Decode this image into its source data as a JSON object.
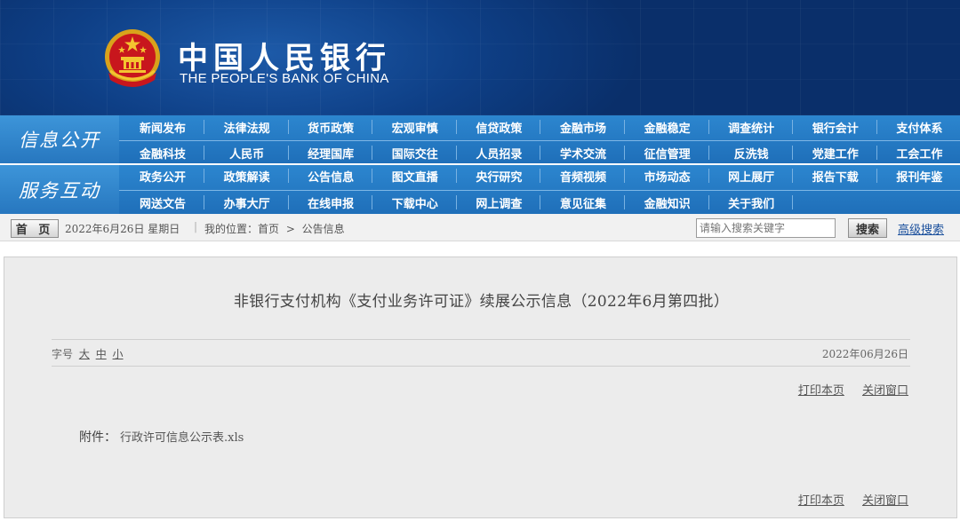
{
  "header": {
    "logo_cn": "中国人民银行",
    "logo_en": "THE PEOPLE'S BANK OF CHINA"
  },
  "nav": {
    "section1": {
      "title": "信息公开",
      "row1": [
        "新闻发布",
        "法律法规",
        "货币政策",
        "宏观审慎",
        "信贷政策",
        "金融市场",
        "金融稳定",
        "调查统计",
        "银行会计",
        "支付体系"
      ],
      "row2": [
        "金融科技",
        "人民币",
        "经理国库",
        "国际交往",
        "人员招录",
        "学术交流",
        "征信管理",
        "反洗钱",
        "党建工作",
        "工会工作"
      ]
    },
    "section2": {
      "title": "服务互动",
      "row1": [
        "政务公开",
        "政策解读",
        "公告信息",
        "图文直播",
        "央行研究",
        "音频视频",
        "市场动态",
        "网上展厅",
        "报告下载",
        "报刊年鉴"
      ],
      "row2": [
        "网送文告",
        "办事大厅",
        "在线申报",
        "下载中心",
        "网上调查",
        "意见征集",
        "金融知识",
        "关于我们"
      ]
    }
  },
  "infobar": {
    "home_label": "首 页",
    "date": "2022年6月26日 星期日",
    "separator": "|",
    "location": "我的位置：首页 > 公告信息",
    "search_placeholder": "请输入搜索关键字",
    "search_button": "搜索",
    "advanced_search": "高级搜索"
  },
  "article": {
    "title": "非银行支付机构《支付业务许可证》续展公示信息（2022年6月第四批）",
    "font_size_label": "字号",
    "font_large": "大",
    "font_medium": "中",
    "font_small": "小",
    "date": "2022年06月26日",
    "print_label": "打印本页",
    "close_label": "关闭窗口",
    "attachment_label": "附件：",
    "attachment_file": "行政许可信息公示表.xls"
  }
}
